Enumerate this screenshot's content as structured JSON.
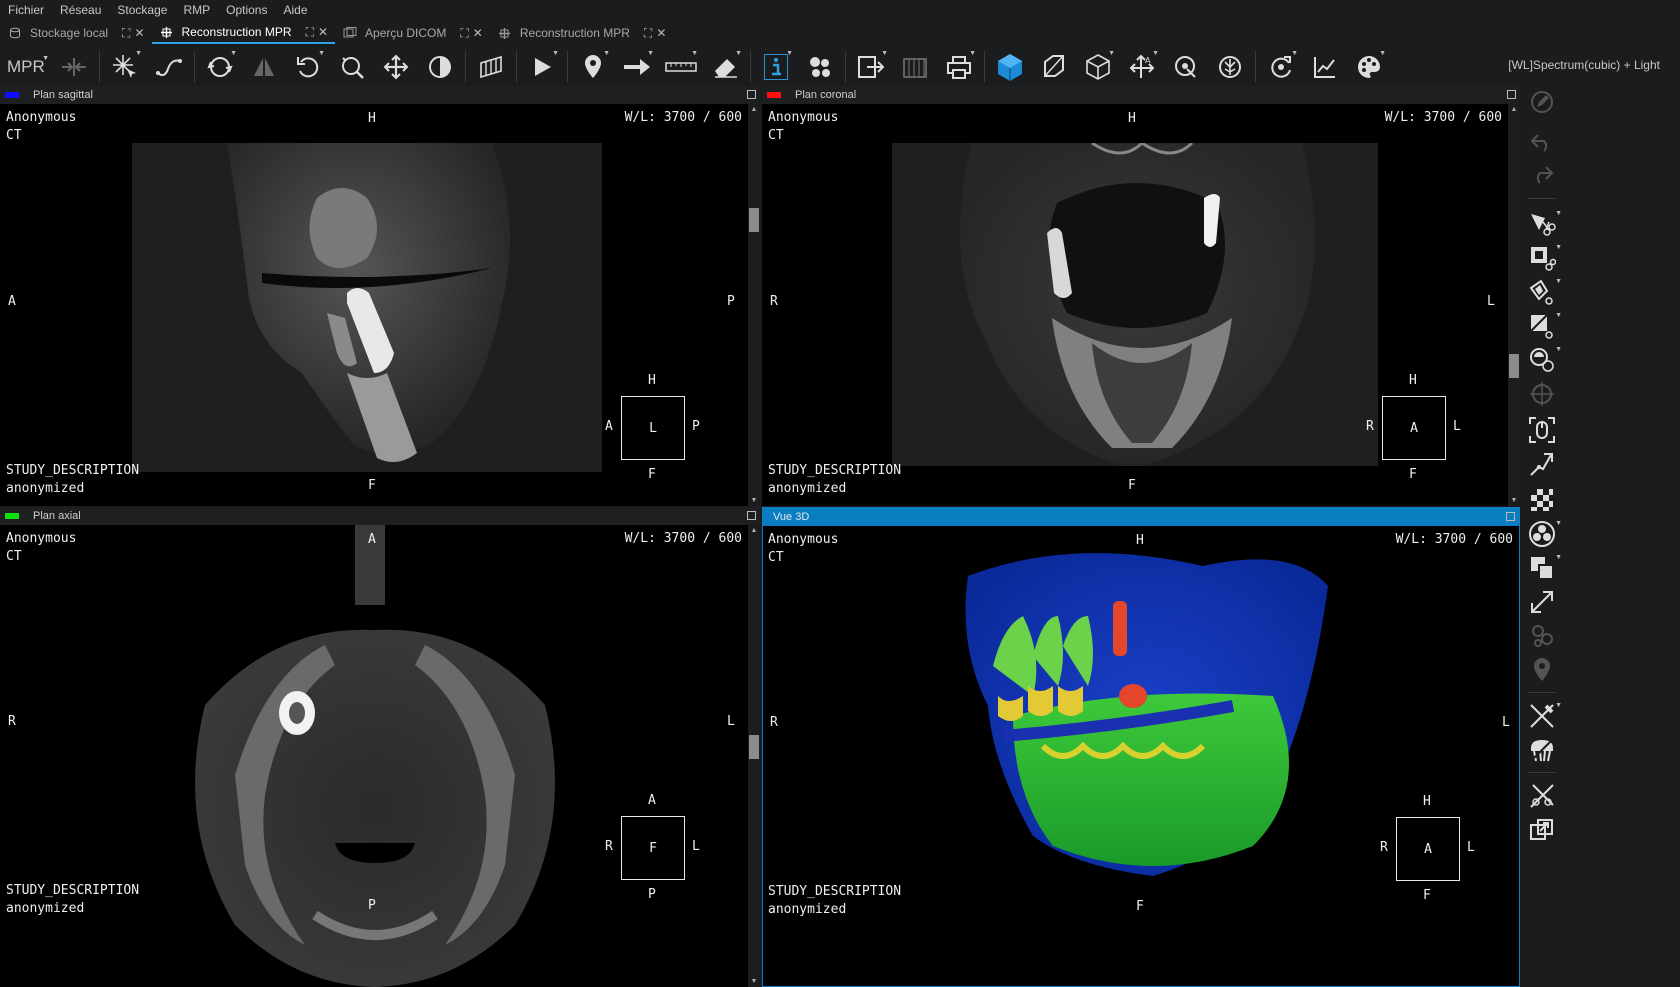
{
  "menu": [
    "Fichier",
    "Réseau",
    "Stockage",
    "RMP",
    "Options",
    "Aide"
  ],
  "tabs": [
    {
      "label": "Stockage local",
      "active": false,
      "icon": "database-icon"
    },
    {
      "label": "Reconstruction MPR",
      "active": true,
      "icon": "mpr-icon"
    },
    {
      "label": "Aperçu DICOM",
      "active": false,
      "icon": "dicom-preview-icon"
    },
    {
      "label": "Reconstruction MPR",
      "active": false,
      "icon": "mpr-icon"
    }
  ],
  "toolbar": {
    "mode_label": "MPR",
    "preset_label": "[WL]Spectrum(cubic) + Light"
  },
  "panels": {
    "sagittal": {
      "title": "Plan sagittal",
      "swatch": "#1010ff",
      "patient": "Anonymous",
      "modality": "CT",
      "wl": "W/L: 3700 / 600",
      "study": "STUDY_DESCRIPTION",
      "anon": "anonymized",
      "top": "H",
      "bottom": "F",
      "left": "A",
      "right": "P",
      "cube": {
        "top": "H",
        "left": "A",
        "center": "L",
        "right": "P",
        "bottom": "F"
      }
    },
    "coronal": {
      "title": "Plan coronal",
      "swatch": "#ff1010",
      "patient": "Anonymous",
      "modality": "CT",
      "wl": "W/L: 3700 / 600",
      "study": "STUDY_DESCRIPTION",
      "anon": "anonymized",
      "top": "H",
      "bottom": "F",
      "left": "R",
      "right": "L",
      "cube": {
        "top": "H",
        "left": "R",
        "center": "A",
        "right": "L",
        "bottom": "F"
      }
    },
    "axial": {
      "title": "Plan axial",
      "swatch": "#10e010",
      "patient": "Anonymous",
      "modality": "CT",
      "wl": "W/L: 3700 / 600",
      "study": "STUDY_DESCRIPTION",
      "anon": "anonymized",
      "top": "A",
      "bottom": "P",
      "left": "R",
      "right": "L",
      "cube": {
        "top": "A",
        "left": "R",
        "center": "F",
        "right": "L",
        "bottom": "P"
      }
    },
    "vue3d": {
      "title": "Vue 3D",
      "patient": "Anonymous",
      "modality": "CT",
      "wl": "W/L: 3700 / 600",
      "study": "STUDY_DESCRIPTION",
      "anon": "anonymized",
      "top": "H",
      "bottom": "F",
      "left": "R",
      "right": "L",
      "cube": {
        "top": "H",
        "left": "R",
        "center": "A",
        "right": "L",
        "bottom": "F"
      }
    }
  }
}
